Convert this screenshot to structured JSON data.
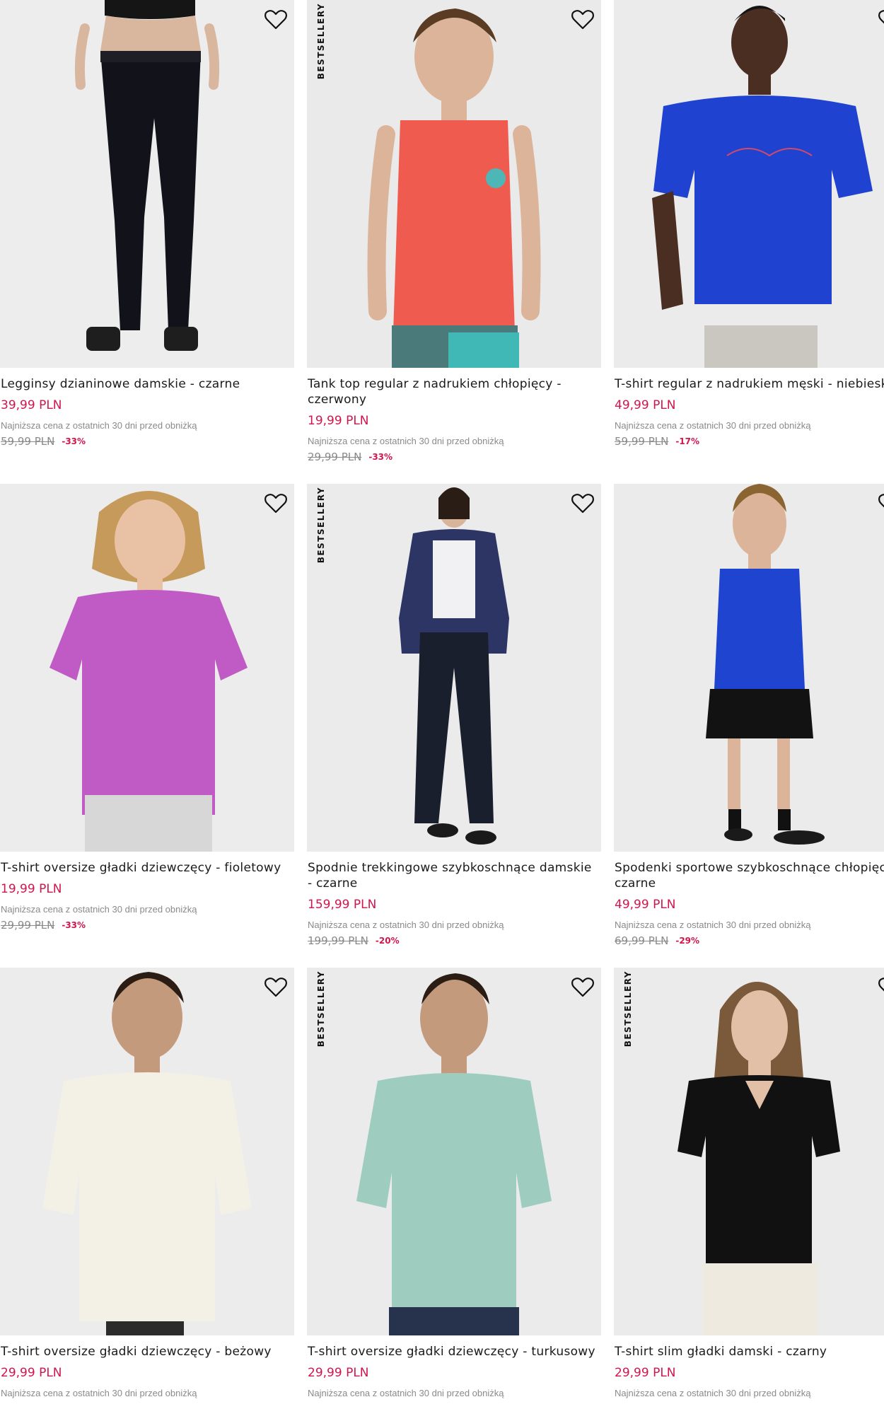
{
  "colors": {
    "accent": "#d0164d",
    "muted": "#8a8a8a",
    "photo_bg": "#ebebeb"
  },
  "badge_label": "BESTSELLERY",
  "products": [
    {
      "title": "Legginsy dzianinowe damskie - czarne",
      "price": "39,99 PLN",
      "lowest_note": "Najniższa cena z ostatnich 30 dni przed obniżką",
      "old_price": "59,99 PLN",
      "discount": "-33%",
      "bestseller": false
    },
    {
      "title": "Tank top regular z nadrukiem chłopięcy - czerwony",
      "price": "19,99 PLN",
      "lowest_note": "Najniższa cena z ostatnich 30 dni przed obniżką",
      "old_price": "29,99 PLN",
      "discount": "-33%",
      "bestseller": true
    },
    {
      "title": "T-shirt regular z nadrukiem męski - niebieski",
      "price": "49,99 PLN",
      "lowest_note": "Najniższa cena z ostatnich 30 dni przed obniżką",
      "old_price": "59,99 PLN",
      "discount": "-17%",
      "bestseller": false
    },
    {
      "title": "T-shirt oversize gładki dziewczęcy - fioletowy",
      "price": "19,99 PLN",
      "lowest_note": "Najniższa cena z ostatnich 30 dni przed obniżką",
      "old_price": "29,99 PLN",
      "discount": "-33%",
      "bestseller": false
    },
    {
      "title": "Spodnie trekkingowe szybkoschnące damskie - czarne",
      "price": "159,99 PLN",
      "lowest_note": "Najniższa cena z ostatnich 30 dni przed obniżką",
      "old_price": "199,99 PLN",
      "discount": "-20%",
      "bestseller": true
    },
    {
      "title": "Spodenki sportowe szybkoschnące chłopięce - czarne",
      "price": "49,99 PLN",
      "lowest_note": "Najniższa cena z ostatnich 30 dni przed obniżką",
      "old_price": "69,99 PLN",
      "discount": "-29%",
      "bestseller": false
    },
    {
      "title": "T-shirt oversize gładki dziewczęcy - beżowy",
      "price": "29,99 PLN",
      "lowest_note": "Najniższa cena z ostatnich 30 dni przed obniżką",
      "bestseller": false
    },
    {
      "title": "T-shirt oversize gładki dziewczęcy - turkusowy",
      "price": "29,99 PLN",
      "lowest_note": "Najniższa cena z ostatnich 30 dni przed obniżką",
      "bestseller": true
    },
    {
      "title": "T-shirt slim gładki damski - czarny",
      "price": "29,99 PLN",
      "lowest_note": "Najniższa cena z ostatnich 30 dni przed obniżką",
      "bestseller": true
    }
  ]
}
